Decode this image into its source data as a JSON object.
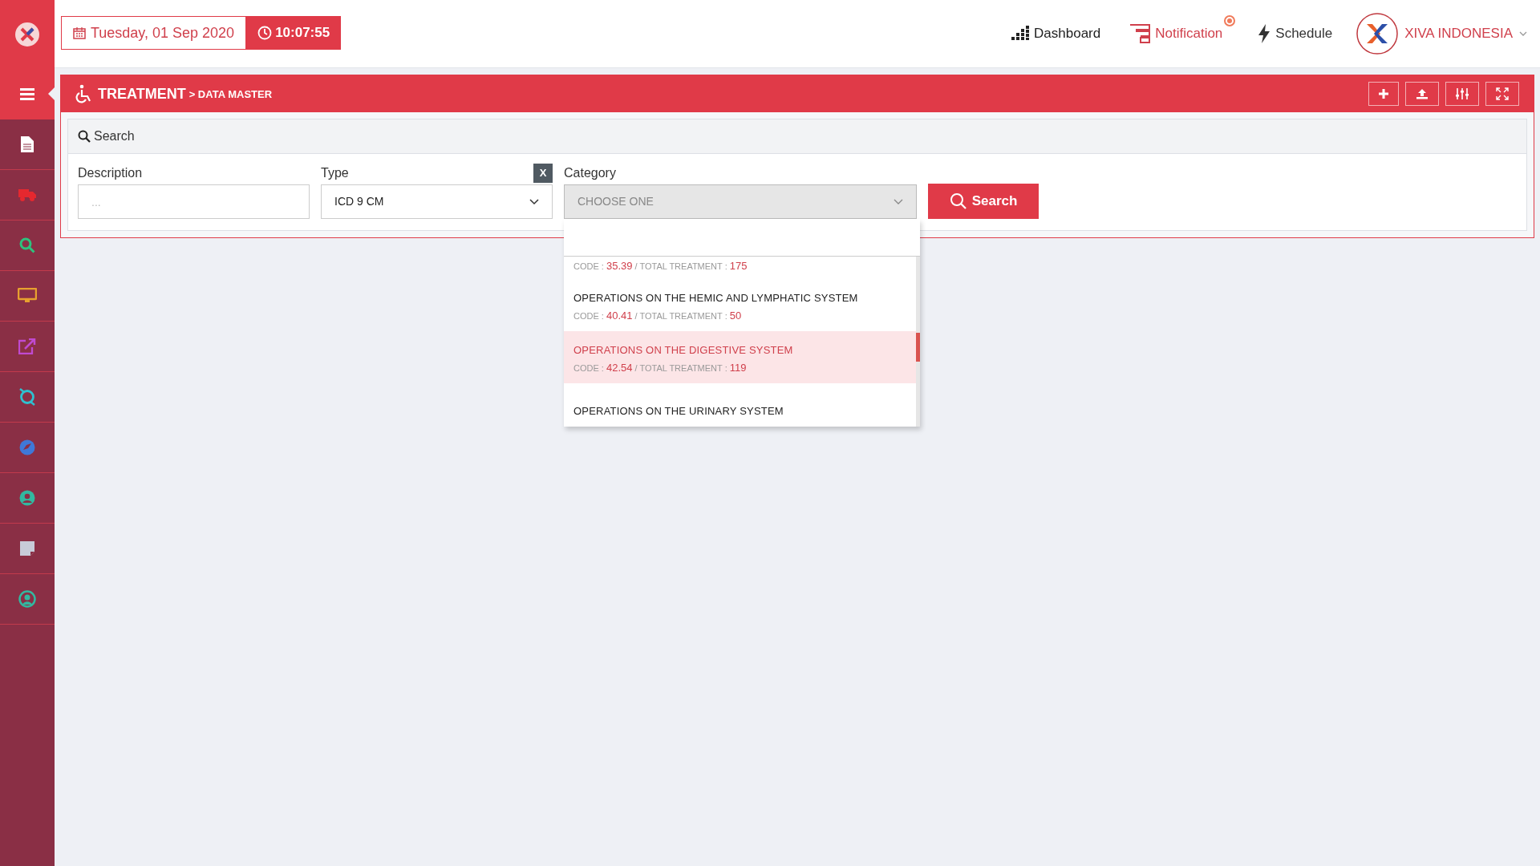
{
  "topbar": {
    "date": "Tuesday, 01 Sep 2020",
    "time": "10:07:55"
  },
  "nav": [
    {
      "label": "Dashboard",
      "kind": "dashboard",
      "badge": false
    },
    {
      "label": "Notification",
      "kind": "notification",
      "badge": true
    },
    {
      "label": "Schedule",
      "kind": "schedule",
      "badge": false
    }
  ],
  "user": {
    "name": "XIVA INDONESIA"
  },
  "sidebar": {
    "items": [
      {
        "kind": "document"
      },
      {
        "kind": "truck"
      },
      {
        "kind": "search"
      },
      {
        "kind": "monitor"
      },
      {
        "kind": "external"
      },
      {
        "kind": "ring"
      },
      {
        "kind": "compass"
      },
      {
        "kind": "user"
      },
      {
        "kind": "note"
      },
      {
        "kind": "account"
      }
    ]
  },
  "page": {
    "title": "TREATMENT",
    "breadcrumb": "> DATA MASTER"
  },
  "search_panel": {
    "title": "Search",
    "description": {
      "label": "Description",
      "placeholder": "..."
    },
    "type": {
      "label": "Type",
      "value": "ICD 9 CM",
      "clear": "X"
    },
    "category": {
      "label": "Category",
      "placeholder": "CHOOSE ONE",
      "expanded": true
    },
    "button": "Search"
  },
  "dropdown": {
    "items": [
      {
        "code_label": "CODE :",
        "code": "35.39",
        "total_label": "/ TOTAL TREATMENT :",
        "total": "175",
        "selected": false
      },
      {
        "title": "OPERATIONS ON THE HEMIC AND LYMPHATIC SYSTEM",
        "code_label": "CODE :",
        "code": "40.41",
        "total_label": "/ TOTAL TREATMENT :",
        "total": "50",
        "selected": false
      },
      {
        "title": "OPERATIONS ON THE DIGESTIVE SYSTEM",
        "code_label": "CODE :",
        "code": "42.54",
        "total_label": "/ TOTAL TREATMENT :",
        "total": "119",
        "selected": true
      },
      {
        "title": "OPERATIONS ON THE URINARY SYSTEM",
        "selected": false
      }
    ]
  }
}
